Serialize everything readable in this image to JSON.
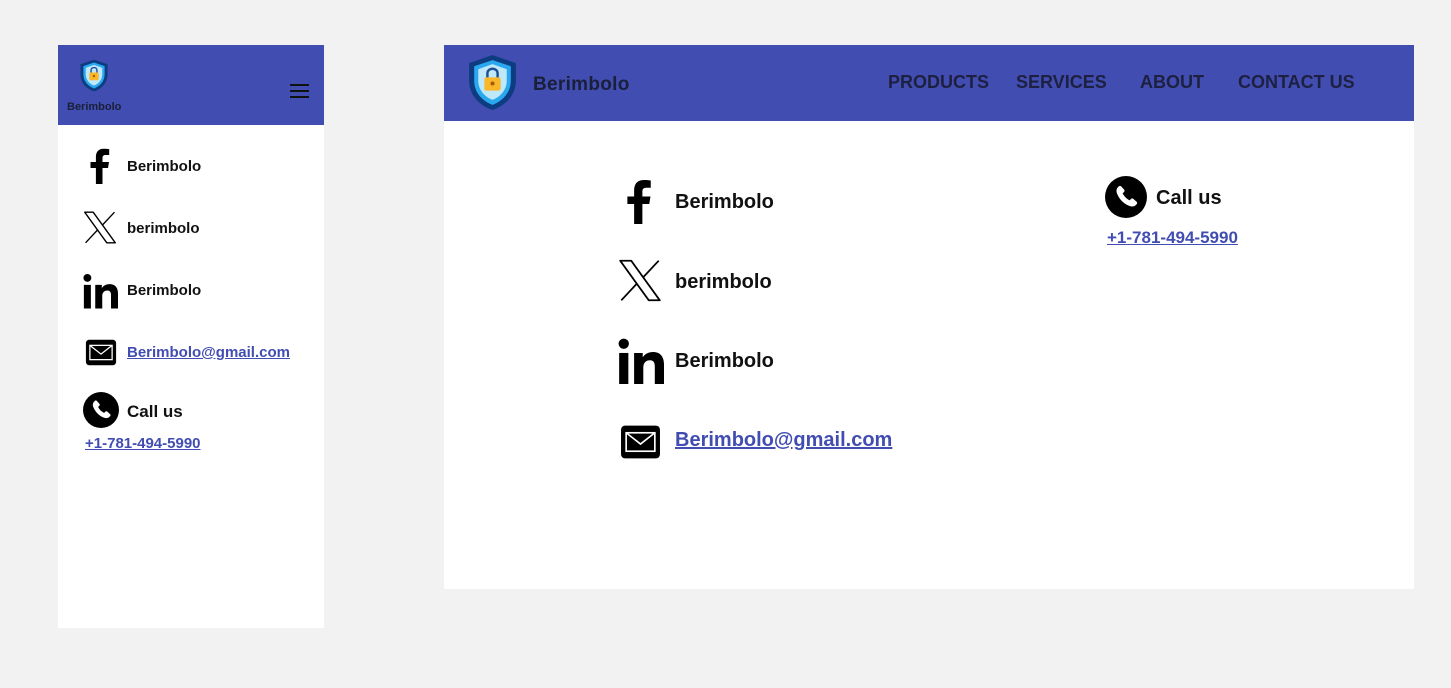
{
  "brand": {
    "name": "Berimbolo",
    "accent": "#414db1"
  },
  "nav": {
    "products": "PRODUCTS",
    "services": "SERVICES",
    "about": "ABOUT",
    "contact": "CONTACT US"
  },
  "socials": {
    "facebook": {
      "icon": "facebook-icon",
      "label": "Berimbolo"
    },
    "x": {
      "icon": "x-icon",
      "label": "berimbolo"
    },
    "linkedin": {
      "icon": "linkedin-icon",
      "label": "Berimbolo"
    },
    "email": {
      "icon": "mail-icon",
      "label": "Berimbolo@gmail.com"
    }
  },
  "call": {
    "icon": "phone-icon",
    "label": "Call us",
    "phone": "+1-781-494-5990"
  }
}
